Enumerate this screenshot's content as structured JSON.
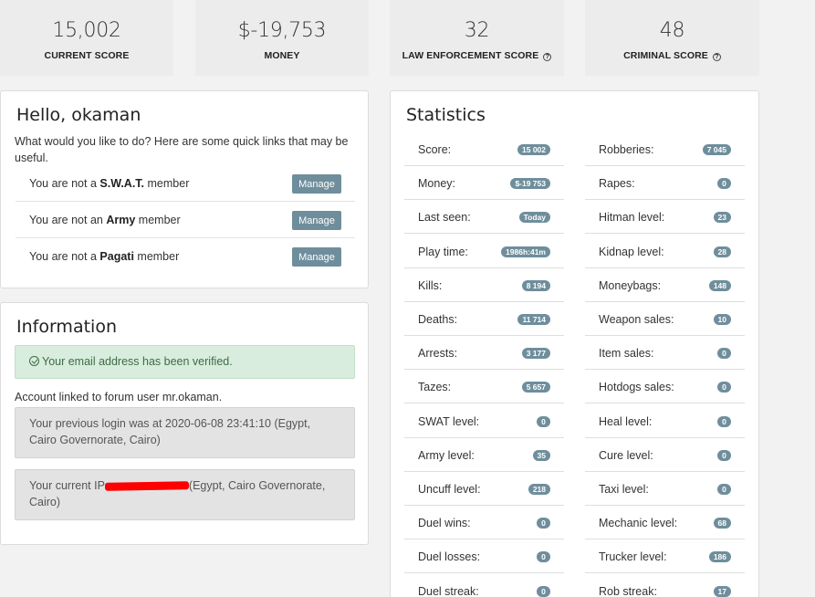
{
  "top_stats": [
    {
      "value": "15,002",
      "label": "CURRENT SCORE",
      "help": false
    },
    {
      "value": "$-19,753",
      "label": "MONEY",
      "help": false
    },
    {
      "value": "32",
      "label": "LAW ENFORCEMENT SCORE",
      "help": true
    },
    {
      "value": "48",
      "label": "CRIMINAL SCORE",
      "help": true
    }
  ],
  "hello": {
    "title": "Hello, okaman",
    "intro": "What would you like to do? Here are some quick links that may be useful.",
    "memberships": [
      {
        "prefix": "You are not a",
        "group": "S.W.A.T.",
        "suffix": "member",
        "button": "Manage"
      },
      {
        "prefix": "You are not an",
        "group": "Army",
        "suffix": "member",
        "button": "Manage"
      },
      {
        "prefix": "You are not a",
        "group": "Pagati",
        "suffix": "member",
        "button": "Manage"
      }
    ]
  },
  "information": {
    "title": "Information",
    "verified": "Your email address has been verified.",
    "linked": "Account linked to forum user mr.okaman.",
    "previous_login": "Your previous login was at 2020-06-08 23:41:10 (Egypt, Cairo Governorate, Cairo)",
    "current_ip_prefix": "Your current IP",
    "current_ip_suffix": "(Egypt, Cairo Governorate, Cairo)"
  },
  "statistics": {
    "title": "Statistics",
    "left": [
      {
        "label": "Score:",
        "value": "15 002"
      },
      {
        "label": "Money:",
        "value": "$-19 753"
      },
      {
        "label": "Last seen:",
        "value": "Today"
      },
      {
        "label": "Play time:",
        "value": "1986h:41m"
      },
      {
        "label": "Kills:",
        "value": "8 194"
      },
      {
        "label": "Deaths:",
        "value": "11 714"
      },
      {
        "label": "Arrests:",
        "value": "3 177"
      },
      {
        "label": "Tazes:",
        "value": "5 657"
      },
      {
        "label": "SWAT level:",
        "value": "0"
      },
      {
        "label": "Army level:",
        "value": "35"
      },
      {
        "label": "Uncuff level:",
        "value": "218"
      },
      {
        "label": "Duel wins:",
        "value": "0"
      },
      {
        "label": "Duel losses:",
        "value": "0"
      },
      {
        "label": "Duel streak:",
        "value": "0"
      }
    ],
    "right": [
      {
        "label": "Robberies:",
        "value": "7 045"
      },
      {
        "label": "Rapes:",
        "value": "0"
      },
      {
        "label": "Hitman level:",
        "value": "23"
      },
      {
        "label": "Kidnap level:",
        "value": "28"
      },
      {
        "label": "Moneybags:",
        "value": "148"
      },
      {
        "label": "Weapon sales:",
        "value": "10"
      },
      {
        "label": "Item sales:",
        "value": "0"
      },
      {
        "label": "Hotdogs sales:",
        "value": "0"
      },
      {
        "label": "Heal level:",
        "value": "0"
      },
      {
        "label": "Cure level:",
        "value": "0"
      },
      {
        "label": "Taxi level:",
        "value": "0"
      },
      {
        "label": "Mechanic level:",
        "value": "68"
      },
      {
        "label": "Trucker level:",
        "value": "186"
      },
      {
        "label": "Rob streak:",
        "value": "17"
      }
    ]
  }
}
